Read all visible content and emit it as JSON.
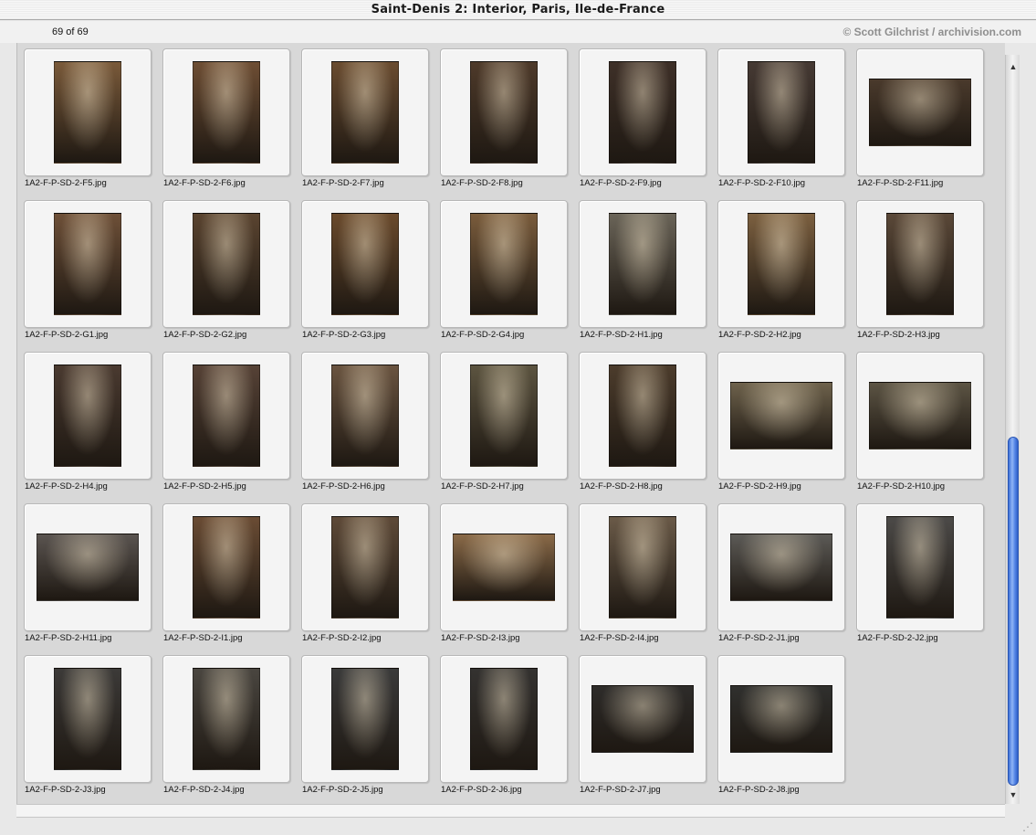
{
  "window": {
    "title": "Saint-Denis 2: Interior, Paris, Ile-de-France"
  },
  "header": {
    "count": "69 of 69",
    "copyright": "© Scott Gilchrist / archivision.com"
  },
  "colors": {
    "scroll_thumb": "#4a7ee0",
    "panel_background": "#d8d8d8"
  },
  "items": [
    {
      "label": "1A2-F-P-SD-2-F5.jpg",
      "orientation": "portrait",
      "tone": "#7a5a3a"
    },
    {
      "label": "1A2-F-P-SD-2-F6.jpg",
      "orientation": "portrait",
      "tone": "#6e4e34"
    },
    {
      "label": "1A2-F-P-SD-2-F7.jpg",
      "orientation": "portrait",
      "tone": "#6a4c30"
    },
    {
      "label": "1A2-F-P-SD-2-F8.jpg",
      "orientation": "portrait",
      "tone": "#4e3a2a"
    },
    {
      "label": "1A2-F-P-SD-2-F9.jpg",
      "orientation": "portrait",
      "tone": "#3e3028"
    },
    {
      "label": "1A2-F-P-SD-2-F10.jpg",
      "orientation": "portrait",
      "tone": "#463a34"
    },
    {
      "label": "1A2-F-P-SD-2-F11.jpg",
      "orientation": "landscape",
      "tone": "#4a3a2c"
    },
    {
      "label": "1A2-F-P-SD-2-G1.jpg",
      "orientation": "portrait",
      "tone": "#6e5038"
    },
    {
      "label": "1A2-F-P-SD-2-G2.jpg",
      "orientation": "portrait",
      "tone": "#5a4430"
    },
    {
      "label": "1A2-F-P-SD-2-G3.jpg",
      "orientation": "portrait",
      "tone": "#6a4a2c"
    },
    {
      "label": "1A2-F-P-SD-2-G4.jpg",
      "orientation": "portrait",
      "tone": "#7a5c3c"
    },
    {
      "label": "1A2-F-P-SD-2-H1.jpg",
      "orientation": "portrait",
      "tone": "#6a6458"
    },
    {
      "label": "1A2-F-P-SD-2-H2.jpg",
      "orientation": "portrait",
      "tone": "#7c6040"
    },
    {
      "label": "1A2-F-P-SD-2-H3.jpg",
      "orientation": "portrait",
      "tone": "#5a4838"
    },
    {
      "label": "1A2-F-P-SD-2-H4.jpg",
      "orientation": "portrait",
      "tone": "#4a3a30"
    },
    {
      "label": "1A2-F-P-SD-2-H5.jpg",
      "orientation": "portrait",
      "tone": "#564236"
    },
    {
      "label": "1A2-F-P-SD-2-H6.jpg",
      "orientation": "portrait",
      "tone": "#6a5440"
    },
    {
      "label": "1A2-F-P-SD-2-H7.jpg",
      "orientation": "portrait",
      "tone": "#5c5440"
    },
    {
      "label": "1A2-F-P-SD-2-H8.jpg",
      "orientation": "portrait",
      "tone": "#4c3c2c"
    },
    {
      "label": "1A2-F-P-SD-2-H9.jpg",
      "orientation": "landscape",
      "tone": "#6e624c"
    },
    {
      "label": "1A2-F-P-SD-2-H10.jpg",
      "orientation": "landscape",
      "tone": "#5c5444"
    },
    {
      "label": "1A2-F-P-SD-2-H11.jpg",
      "orientation": "landscape",
      "tone": "#5a5450"
    },
    {
      "label": "1A2-F-P-SD-2-I1.jpg",
      "orientation": "portrait",
      "tone": "#6a4c34"
    },
    {
      "label": "1A2-F-P-SD-2-I2.jpg",
      "orientation": "portrait",
      "tone": "#5e4a38"
    },
    {
      "label": "1A2-F-P-SD-2-I3.jpg",
      "orientation": "landscape",
      "tone": "#8a6a48"
    },
    {
      "label": "1A2-F-P-SD-2-I4.jpg",
      "orientation": "portrait",
      "tone": "#6a5a48"
    },
    {
      "label": "1A2-F-P-SD-2-J1.jpg",
      "orientation": "landscape",
      "tone": "#5c5a56"
    },
    {
      "label": "1A2-F-P-SD-2-J2.jpg",
      "orientation": "portrait",
      "tone": "#4c4a48"
    },
    {
      "label": "1A2-F-P-SD-2-J3.jpg",
      "orientation": "portrait",
      "tone": "#3c3a38"
    },
    {
      "label": "1A2-F-P-SD-2-J4.jpg",
      "orientation": "portrait",
      "tone": "#4a4640"
    },
    {
      "label": "1A2-F-P-SD-2-J5.jpg",
      "orientation": "portrait",
      "tone": "#3a3a3a"
    },
    {
      "label": "1A2-F-P-SD-2-J6.jpg",
      "orientation": "portrait",
      "tone": "#343230"
    },
    {
      "label": "1A2-F-P-SD-2-J7.jpg",
      "orientation": "landscape",
      "tone": "#2e2c2a"
    },
    {
      "label": "1A2-F-P-SD-2-J8.jpg",
      "orientation": "landscape",
      "tone": "#30302e"
    }
  ]
}
